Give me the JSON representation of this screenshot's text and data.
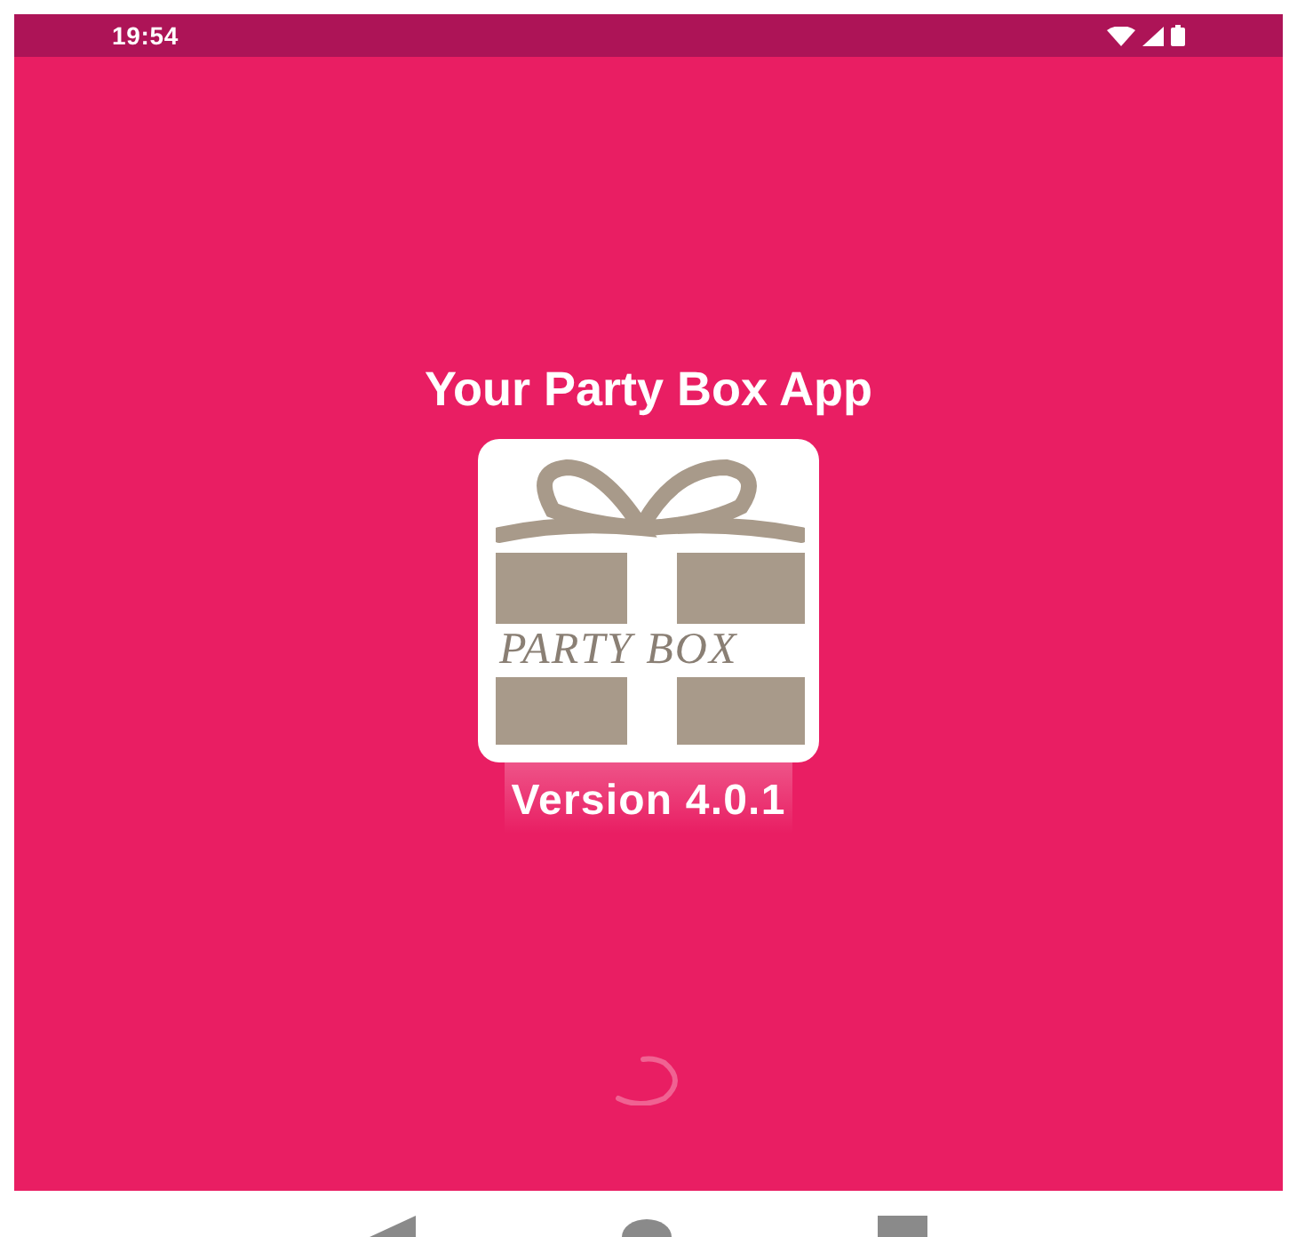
{
  "status_bar": {
    "time": "19:54"
  },
  "splash": {
    "title": "Your Party Box App",
    "logo_text": "PARTY BOX",
    "version": "Version 4.0.1",
    "loading": true
  }
}
